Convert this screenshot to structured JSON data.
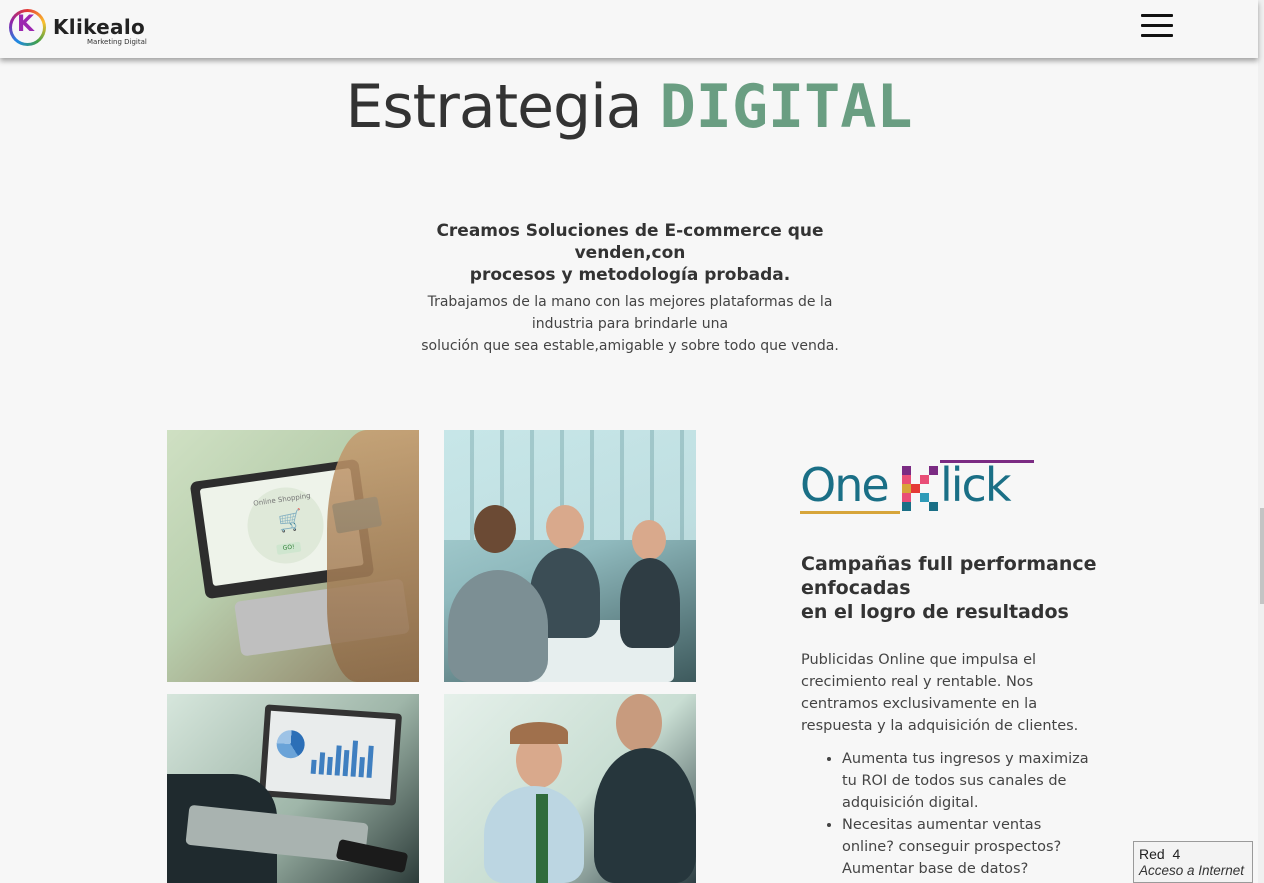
{
  "header": {
    "brand_name": "Klikealo",
    "brand_tagline": "Marketing Digital",
    "logo_letter": "K",
    "menu_icon": "hamburger-icon"
  },
  "hero": {
    "title_main": "Estrategia",
    "title_accent": "DIGITAL",
    "accent_color": "#6a9e82"
  },
  "intro": {
    "subheading_line1": "Creamos Soluciones de E-commerce que venden,con",
    "subheading_line2": "procesos y metodología probada.",
    "body_line1": "Trabajamos de la mano con las mejores plataformas de la",
    "body_line2": "industria para brindarle una",
    "body_line3": "solución que sea estable,amigable y sobre todo que venda."
  },
  "photos": {
    "online_shopping_text": "Online Shopping",
    "go_text": "GO!"
  },
  "oneklick": {
    "part1": "One",
    "part2": "lick",
    "brand_color": "#1a6f86"
  },
  "campaign": {
    "title_line1": "Campañas full performance",
    "title_line2": "enfocadas",
    "title_line3": "en el logro de resultados",
    "body": "Publicidas Online que impulsa el crecimiento real y rentable. Nos centramos exclusivamente en la respuesta y la adquisición de clientes.",
    "bullets": [
      "Aumenta tus ingresos y maximiza tu ROI de todos sus canales de adquisición digital.",
      "Necesitas aumentar ventas online? conseguir prospectos? Aumentar base de datos?"
    ]
  },
  "network_tooltip": {
    "line1": "Red  4",
    "line2": "Acceso a Internet"
  }
}
